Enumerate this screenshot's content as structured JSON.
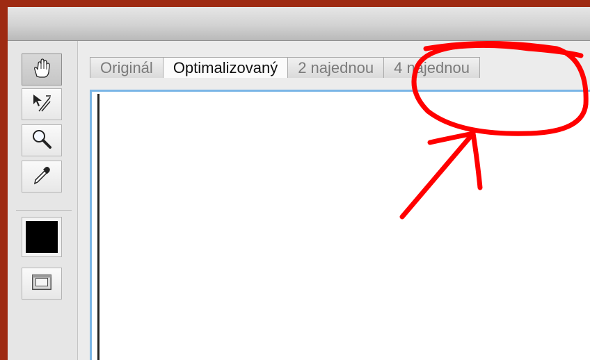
{
  "window": {
    "title": ""
  },
  "toolbox": {
    "tools": [
      {
        "icon": "hand-icon"
      },
      {
        "icon": "slice-select-icon"
      },
      {
        "icon": "zoom-icon"
      },
      {
        "icon": "eyedropper-icon"
      }
    ],
    "swatch_color": "#000000",
    "screen_button_icon": "screen-mode-icon"
  },
  "tabs": [
    {
      "label": "Originál"
    },
    {
      "label": "Optimalizovaný"
    },
    {
      "label": "2 najednou"
    },
    {
      "label": "4 najednou"
    }
  ],
  "selected_tab": "Optimalizovaný",
  "annotation": {
    "color": "#ff0000",
    "target": "4 najednou"
  },
  "colors": {
    "background": "#9e2a12",
    "canvas_border": "#7ab6e6",
    "annotation": "#ff0000"
  }
}
